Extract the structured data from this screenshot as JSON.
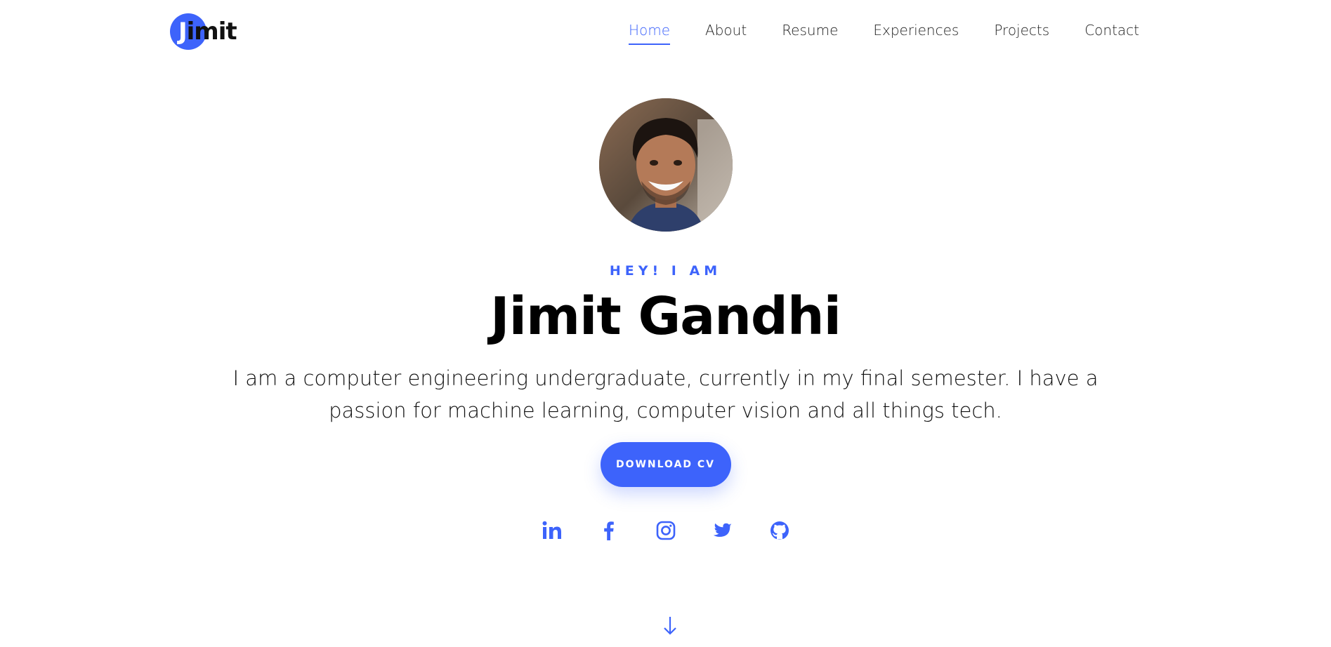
{
  "header": {
    "logo_text": "Jimit",
    "logo_initial": "J",
    "logo_rest": "imit",
    "nav": [
      {
        "label": "Home",
        "active": true
      },
      {
        "label": "About",
        "active": false
      },
      {
        "label": "Resume",
        "active": false
      },
      {
        "label": "Experiences",
        "active": false
      },
      {
        "label": "Projects",
        "active": false
      },
      {
        "label": "Contact",
        "active": false
      }
    ]
  },
  "hero": {
    "greeting": "HEY! I AM",
    "name": "Jimit Gandhi",
    "bio": "I am a computer engineering undergraduate, currently in my final semester. I have a passion for machine learning, computer vision and all things tech.",
    "cta_label": "DOWNLOAD CV"
  },
  "socials": [
    {
      "name": "linkedin-icon"
    },
    {
      "name": "facebook-icon"
    },
    {
      "name": "instagram-icon"
    },
    {
      "name": "twitter-icon"
    },
    {
      "name": "github-icon"
    }
  ],
  "colors": {
    "accent": "#3d63fb",
    "text": "#111111",
    "background": "#ffffff"
  },
  "icons": {
    "scroll": "arrow-down-icon"
  }
}
